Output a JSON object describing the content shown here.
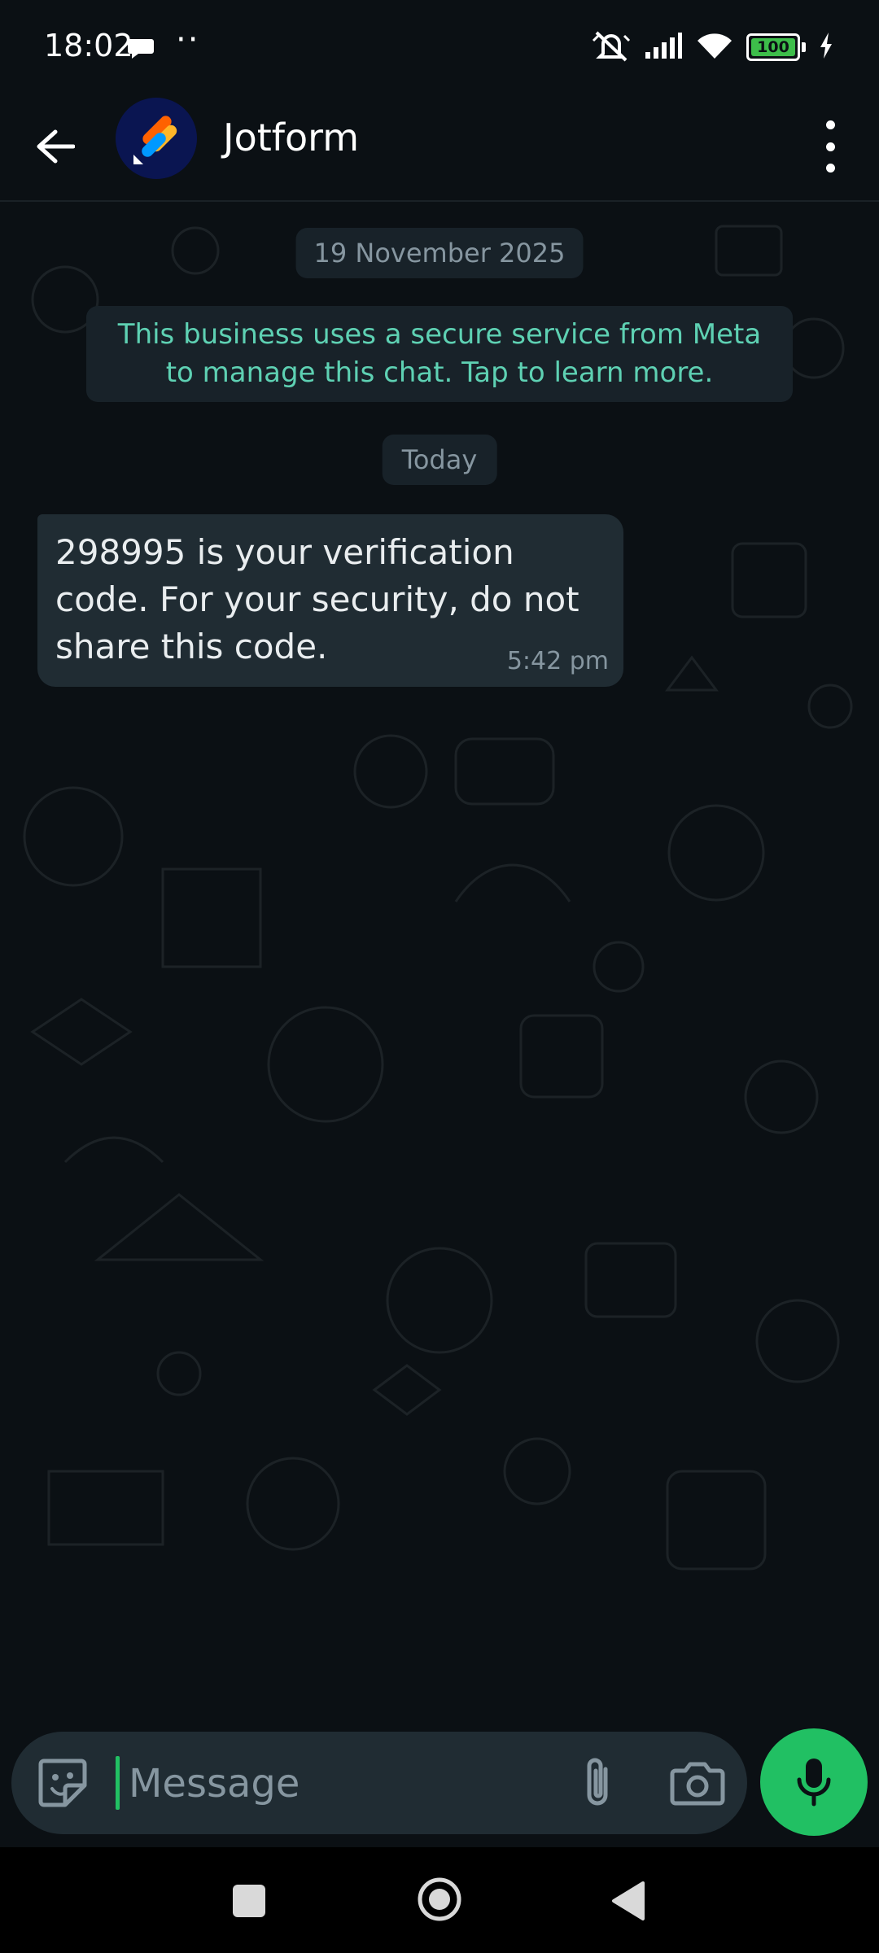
{
  "status_bar": {
    "time": "18:02",
    "dots": "··",
    "battery": "100"
  },
  "header": {
    "contact_name": "Jotform",
    "avatar_icon": "jotform-logo-icon"
  },
  "chat": {
    "date_chip": "19 November 2025",
    "system_note": "This business uses a secure service from Meta to manage this chat. Tap to learn more.",
    "today_chip": "Today",
    "messages": [
      {
        "text": "298995 is your verification code. For your security, do not share this code.",
        "time": "5:42 pm"
      }
    ]
  },
  "composer": {
    "placeholder": "Message"
  },
  "colors": {
    "accent_green": "#21c063",
    "system_note_text": "#5ed1b3",
    "bubble_bg": "#202c33",
    "app_bg": "#0b1014"
  }
}
